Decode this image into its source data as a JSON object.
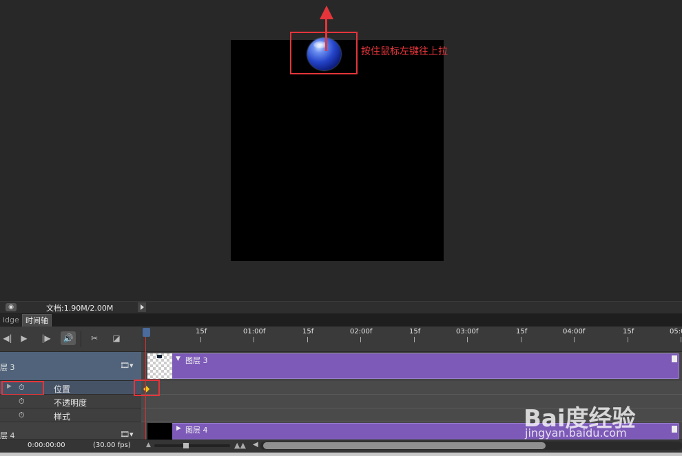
{
  "annotation": "按住鼠标左键往上拉",
  "status": {
    "document_info": "文档:1.90M/2.00M"
  },
  "tabs": [
    {
      "label": "idge"
    },
    {
      "label": "时间轴"
    }
  ],
  "controls": {
    "prev": "◀|",
    "play": "▶",
    "next": "|▶",
    "audio": "🔊",
    "split": "✂",
    "transition": "◪"
  },
  "ruler": {
    "labels": [
      "15f",
      "01:00f",
      "15f",
      "02:00f",
      "15f",
      "03:00f",
      "15f",
      "04:00f",
      "15f",
      "05:0"
    ]
  },
  "layers": [
    {
      "name": "层 3",
      "bar_label": "图层 3",
      "properties": [
        "位置",
        "不透明度",
        "样式"
      ]
    },
    {
      "name": "层 4",
      "bar_label": "图层 4"
    }
  ],
  "footer": {
    "timecode": "0:00:00:00",
    "fps": "(30.00 fps)"
  },
  "watermark": {
    "logo": "Bai度经验",
    "url": "jingyan.baidu.com"
  },
  "colors": {
    "annotation": "#e5353b",
    "track_bar": "#7d5ab8",
    "keyframe": "#f5c518",
    "playhead": "#d43030"
  },
  "icons": [
    "stopwatch-icon",
    "film-icon",
    "keyframe-diamond-icon",
    "expand-triangle-icon",
    "arrow-up-icon"
  ]
}
